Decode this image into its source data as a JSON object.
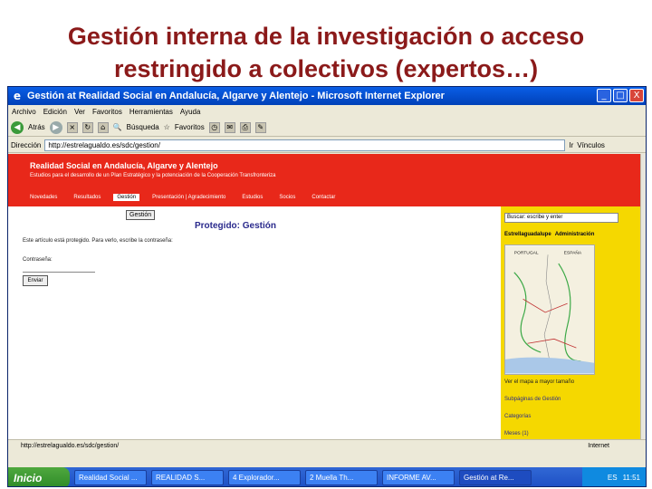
{
  "slide": {
    "title_line1": "Gestión interna de la investigación o acceso",
    "title_line2": "restringido a colectivos (expertos…)"
  },
  "window": {
    "title": "Gestión at Realidad Social en Andalucía, Algarve y Alentejo - Microsoft Internet Explorer",
    "buttons": {
      "minimize": "_",
      "maximize": "□",
      "close": "X"
    }
  },
  "menu": [
    "Archivo",
    "Edición",
    "Ver",
    "Favoritos",
    "Herramientas",
    "Ayuda"
  ],
  "toolbar": {
    "back": "Atrás",
    "search": "Búsqueda",
    "favorites": "Favoritos"
  },
  "address": {
    "label": "Dirección",
    "url": "http://estrelagualdo.es/sdc/gestion/",
    "go": "Ir",
    "links": "Vínculos"
  },
  "site": {
    "title": "Realidad Social en Andalucía, Algarve y Alentejo",
    "subtitle": "Estudios para el desarrollo de un Plan Estratégico y la potenciación de la Cooperación Transfronteriza",
    "nav": [
      "Novedades",
      "Resultados",
      "Gestión",
      "Presentación | Agradecimiento",
      "Estudios",
      "Socios",
      "Contactar"
    ],
    "active_nav": 2
  },
  "content": {
    "gestion_button": "Gestión",
    "heading": "Protegido: Gestión",
    "message": "Este artículo está protegido. Para verlo, escribe la contraseña:",
    "password_label": "Contraseña:",
    "enter_button": "Enviar"
  },
  "sidebar": {
    "search_placeholder": "Buscar: escribe y enter",
    "link1": "Estrellaguadalupe",
    "link2": "Administración",
    "map_label_left": "PORTUGAL",
    "map_label_right": "ESPAÑA",
    "map_caption": "Ver el mapa a mayor tamaño",
    "heading1": "Subpáginas de Gestión",
    "heading2": "Categorías",
    "heading3": "Meses (1)"
  },
  "status": {
    "url": "http://estrelagualdo.es/sdc/gestion/",
    "zone": "Internet"
  },
  "taskbar": {
    "start": "Inicio",
    "tasks": [
      "Realidad Social ...",
      "REALIDAD S...",
      "4 Explorador...",
      "2 Muella Th...",
      "INFORME AV...",
      "Gestión at Re..."
    ],
    "active_task": 5,
    "lang": "ES",
    "clock": "11:51"
  },
  "colors": {
    "title": "#8b1a1a",
    "banner": "#e8281a",
    "sidebar": "#f5d800",
    "heading": "#2a2a8c"
  }
}
